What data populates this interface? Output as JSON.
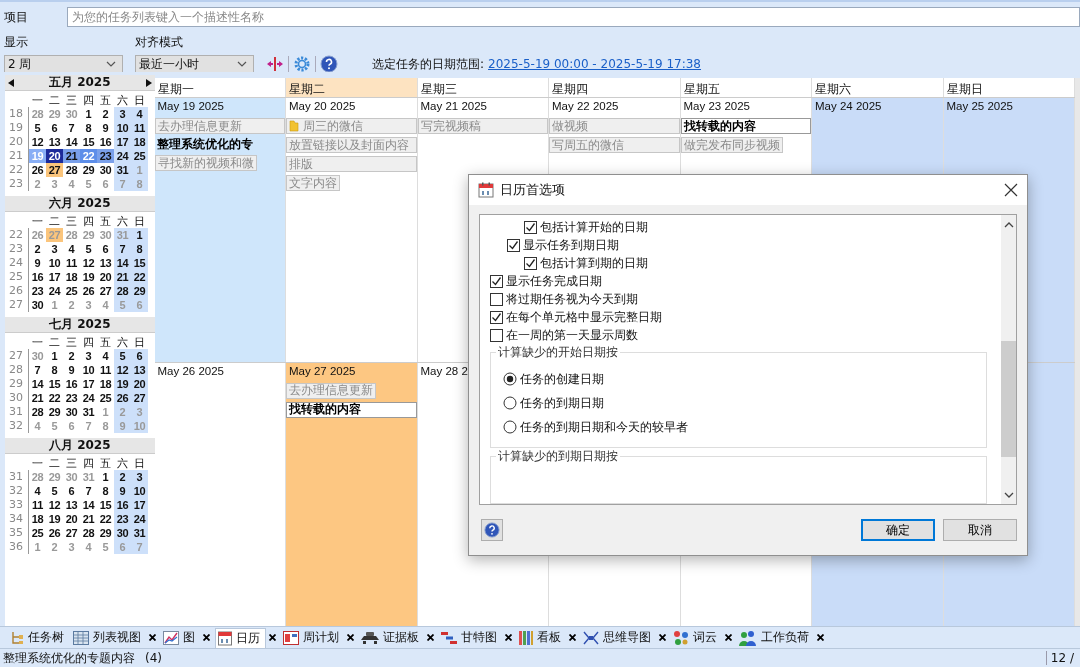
{
  "project": {
    "label": "项目",
    "placeholder": "为您的任务列表键入一个描述性名称"
  },
  "display": {
    "label": "显示",
    "value": "2 周"
  },
  "snap": {
    "label": "对齐模式",
    "value": "最近一小时"
  },
  "range": {
    "label": "选定任务的日期范围:",
    "link": "2025-5-19 00:00 - 2025-5-19 17:38"
  },
  "mini_calendars": [
    {
      "title": "五月 2025",
      "arrows": true,
      "weekdays": [
        "一",
        "二",
        "三",
        "四",
        "五",
        "六",
        "日"
      ],
      "weeks": [
        {
          "number": "18",
          "days": [
            {
              "n": "28",
              "kind": "muted"
            },
            {
              "n": "29",
              "kind": "muted"
            },
            {
              "n": "30",
              "kind": "muted"
            },
            {
              "n": "1",
              "kind": "normal"
            },
            {
              "n": "2",
              "kind": "normal"
            },
            {
              "n": "3",
              "kind": "normal"
            },
            {
              "n": "4",
              "kind": "normal"
            }
          ]
        },
        {
          "number": "19",
          "days": [
            {
              "n": "5",
              "kind": "normal"
            },
            {
              "n": "6",
              "kind": "normal"
            },
            {
              "n": "7",
              "kind": "normal"
            },
            {
              "n": "8",
              "kind": "normal"
            },
            {
              "n": "9",
              "kind": "normal"
            },
            {
              "n": "10",
              "kind": "normal"
            },
            {
              "n": "11",
              "kind": "normal"
            }
          ]
        },
        {
          "number": "20",
          "days": [
            {
              "n": "12",
              "kind": "normal"
            },
            {
              "n": "13",
              "kind": "normal"
            },
            {
              "n": "14",
              "kind": "normal"
            },
            {
              "n": "15",
              "kind": "normal"
            },
            {
              "n": "16",
              "kind": "normal"
            },
            {
              "n": "17",
              "kind": "normal"
            },
            {
              "n": "18",
              "kind": "normal"
            }
          ]
        },
        {
          "number": "21",
          "days": [
            {
              "n": "19",
              "kind": "pale"
            },
            {
              "n": "20",
              "kind": "focused"
            },
            {
              "n": "21",
              "kind": "selected"
            },
            {
              "n": "22",
              "kind": "mid"
            },
            {
              "n": "23",
              "kind": "selected"
            },
            {
              "n": "24",
              "kind": "normal"
            },
            {
              "n": "25",
              "kind": "normal"
            }
          ]
        },
        {
          "number": "22",
          "days": [
            {
              "n": "26",
              "kind": "normal"
            },
            {
              "n": "27",
              "kind": "today"
            },
            {
              "n": "28",
              "kind": "normal"
            },
            {
              "n": "29",
              "kind": "normal"
            },
            {
              "n": "30",
              "kind": "normal"
            },
            {
              "n": "31",
              "kind": "normal"
            },
            {
              "n": "1",
              "kind": "muted"
            }
          ]
        },
        {
          "number": "23",
          "days": [
            {
              "n": "2",
              "kind": "muted"
            },
            {
              "n": "3",
              "kind": "muted"
            },
            {
              "n": "4",
              "kind": "muted"
            },
            {
              "n": "5",
              "kind": "muted"
            },
            {
              "n": "6",
              "kind": "muted"
            },
            {
              "n": "7",
              "kind": "muted"
            },
            {
              "n": "8",
              "kind": "muted"
            }
          ]
        }
      ]
    },
    {
      "title": "六月 2025",
      "arrows": false,
      "weekdays": [
        "一",
        "二",
        "三",
        "四",
        "五",
        "六",
        "日"
      ],
      "weeks": [
        {
          "number": "22",
          "days": [
            {
              "n": "26",
              "kind": "muted"
            },
            {
              "n": "27",
              "kind": "faded"
            },
            {
              "n": "28",
              "kind": "muted"
            },
            {
              "n": "29",
              "kind": "muted"
            },
            {
              "n": "30",
              "kind": "muted"
            },
            {
              "n": "31",
              "kind": "muted"
            },
            {
              "n": "1",
              "kind": "normal"
            }
          ]
        },
        {
          "number": "23",
          "days": [
            {
              "n": "2",
              "kind": "normal"
            },
            {
              "n": "3",
              "kind": "normal"
            },
            {
              "n": "4",
              "kind": "normal"
            },
            {
              "n": "5",
              "kind": "normal"
            },
            {
              "n": "6",
              "kind": "normal"
            },
            {
              "n": "7",
              "kind": "normal"
            },
            {
              "n": "8",
              "kind": "normal"
            }
          ]
        },
        {
          "number": "24",
          "days": [
            {
              "n": "9",
              "kind": "normal"
            },
            {
              "n": "10",
              "kind": "normal"
            },
            {
              "n": "11",
              "kind": "normal"
            },
            {
              "n": "12",
              "kind": "normal"
            },
            {
              "n": "13",
              "kind": "normal"
            },
            {
              "n": "14",
              "kind": "normal"
            },
            {
              "n": "15",
              "kind": "normal"
            }
          ]
        },
        {
          "number": "25",
          "days": [
            {
              "n": "16",
              "kind": "normal"
            },
            {
              "n": "17",
              "kind": "normal"
            },
            {
              "n": "18",
              "kind": "normal"
            },
            {
              "n": "19",
              "kind": "normal"
            },
            {
              "n": "20",
              "kind": "normal"
            },
            {
              "n": "21",
              "kind": "normal"
            },
            {
              "n": "22",
              "kind": "normal"
            }
          ]
        },
        {
          "number": "26",
          "days": [
            {
              "n": "23",
              "kind": "normal"
            },
            {
              "n": "24",
              "kind": "normal"
            },
            {
              "n": "25",
              "kind": "normal"
            },
            {
              "n": "26",
              "kind": "normal"
            },
            {
              "n": "27",
              "kind": "normal"
            },
            {
              "n": "28",
              "kind": "normal"
            },
            {
              "n": "29",
              "kind": "normal"
            }
          ]
        },
        {
          "number": "27",
          "days": [
            {
              "n": "30",
              "kind": "normal"
            },
            {
              "n": "1",
              "kind": "muted"
            },
            {
              "n": "2",
              "kind": "muted"
            },
            {
              "n": "3",
              "kind": "muted"
            },
            {
              "n": "4",
              "kind": "muted"
            },
            {
              "n": "5",
              "kind": "muted"
            },
            {
              "n": "6",
              "kind": "muted"
            }
          ]
        }
      ]
    },
    {
      "title": "七月 2025",
      "arrows": false,
      "weekdays": [
        "一",
        "二",
        "三",
        "四",
        "五",
        "六",
        "日"
      ],
      "weeks": [
        {
          "number": "27",
          "days": [
            {
              "n": "30",
              "kind": "muted"
            },
            {
              "n": "1",
              "kind": "normal"
            },
            {
              "n": "2",
              "kind": "normal"
            },
            {
              "n": "3",
              "kind": "normal"
            },
            {
              "n": "4",
              "kind": "normal"
            },
            {
              "n": "5",
              "kind": "normal"
            },
            {
              "n": "6",
              "kind": "normal"
            }
          ]
        },
        {
          "number": "28",
          "days": [
            {
              "n": "7",
              "kind": "normal"
            },
            {
              "n": "8",
              "kind": "normal"
            },
            {
              "n": "9",
              "kind": "normal"
            },
            {
              "n": "10",
              "kind": "normal"
            },
            {
              "n": "11",
              "kind": "normal"
            },
            {
              "n": "12",
              "kind": "normal"
            },
            {
              "n": "13",
              "kind": "normal"
            }
          ]
        },
        {
          "number": "29",
          "days": [
            {
              "n": "14",
              "kind": "normal"
            },
            {
              "n": "15",
              "kind": "normal"
            },
            {
              "n": "16",
              "kind": "normal"
            },
            {
              "n": "17",
              "kind": "normal"
            },
            {
              "n": "18",
              "kind": "normal"
            },
            {
              "n": "19",
              "kind": "normal"
            },
            {
              "n": "20",
              "kind": "normal"
            }
          ]
        },
        {
          "number": "30",
          "days": [
            {
              "n": "21",
              "kind": "normal"
            },
            {
              "n": "22",
              "kind": "normal"
            },
            {
              "n": "23",
              "kind": "normal"
            },
            {
              "n": "24",
              "kind": "normal"
            },
            {
              "n": "25",
              "kind": "normal"
            },
            {
              "n": "26",
              "kind": "normal"
            },
            {
              "n": "27",
              "kind": "normal"
            }
          ]
        },
        {
          "number": "31",
          "days": [
            {
              "n": "28",
              "kind": "normal"
            },
            {
              "n": "29",
              "kind": "normal"
            },
            {
              "n": "30",
              "kind": "normal"
            },
            {
              "n": "31",
              "kind": "normal"
            },
            {
              "n": "1",
              "kind": "muted"
            },
            {
              "n": "2",
              "kind": "muted"
            },
            {
              "n": "3",
              "kind": "muted"
            }
          ]
        },
        {
          "number": "32",
          "days": [
            {
              "n": "4",
              "kind": "muted"
            },
            {
              "n": "5",
              "kind": "muted"
            },
            {
              "n": "6",
              "kind": "muted"
            },
            {
              "n": "7",
              "kind": "muted"
            },
            {
              "n": "8",
              "kind": "muted"
            },
            {
              "n": "9",
              "kind": "muted"
            },
            {
              "n": "10",
              "kind": "muted"
            }
          ]
        }
      ]
    },
    {
      "title": "八月 2025",
      "arrows": false,
      "weekdays": [
        "一",
        "二",
        "三",
        "四",
        "五",
        "六",
        "日"
      ],
      "weeks": [
        {
          "number": "31",
          "days": [
            {
              "n": "28",
              "kind": "muted"
            },
            {
              "n": "29",
              "kind": "muted"
            },
            {
              "n": "30",
              "kind": "muted"
            },
            {
              "n": "31",
              "kind": "muted"
            },
            {
              "n": "1",
              "kind": "normal"
            },
            {
              "n": "2",
              "kind": "normal"
            },
            {
              "n": "3",
              "kind": "normal"
            }
          ]
        },
        {
          "number": "32",
          "days": [
            {
              "n": "4",
              "kind": "normal"
            },
            {
              "n": "5",
              "kind": "normal"
            },
            {
              "n": "6",
              "kind": "normal"
            },
            {
              "n": "7",
              "kind": "normal"
            },
            {
              "n": "8",
              "kind": "normal"
            },
            {
              "n": "9",
              "kind": "normal"
            },
            {
              "n": "10",
              "kind": "normal"
            }
          ]
        },
        {
          "number": "33",
          "days": [
            {
              "n": "11",
              "kind": "normal"
            },
            {
              "n": "12",
              "kind": "normal"
            },
            {
              "n": "13",
              "kind": "normal"
            },
            {
              "n": "14",
              "kind": "normal"
            },
            {
              "n": "15",
              "kind": "normal"
            },
            {
              "n": "16",
              "kind": "normal"
            },
            {
              "n": "17",
              "kind": "normal"
            }
          ]
        },
        {
          "number": "34",
          "days": [
            {
              "n": "18",
              "kind": "normal"
            },
            {
              "n": "19",
              "kind": "normal"
            },
            {
              "n": "20",
              "kind": "normal"
            },
            {
              "n": "21",
              "kind": "normal"
            },
            {
              "n": "22",
              "kind": "normal"
            },
            {
              "n": "23",
              "kind": "normal"
            },
            {
              "n": "24",
              "kind": "normal"
            }
          ]
        },
        {
          "number": "35",
          "days": [
            {
              "n": "25",
              "kind": "normal"
            },
            {
              "n": "26",
              "kind": "normal"
            },
            {
              "n": "27",
              "kind": "normal"
            },
            {
              "n": "28",
              "kind": "normal"
            },
            {
              "n": "29",
              "kind": "normal"
            },
            {
              "n": "30",
              "kind": "normal"
            },
            {
              "n": "31",
              "kind": "normal"
            }
          ]
        },
        {
          "number": "36",
          "days": [
            {
              "n": "1",
              "kind": "muted"
            },
            {
              "n": "2",
              "kind": "muted"
            },
            {
              "n": "3",
              "kind": "muted"
            },
            {
              "n": "4",
              "kind": "muted"
            },
            {
              "n": "5",
              "kind": "muted"
            },
            {
              "n": "6",
              "kind": "muted"
            },
            {
              "n": "7",
              "kind": "muted"
            }
          ]
        }
      ]
    }
  ],
  "calendar": {
    "day_names": [
      {
        "label": "星期一",
        "today": false
      },
      {
        "label": "星期二",
        "today": true
      },
      {
        "label": "星期三",
        "today": false
      },
      {
        "label": "星期四",
        "today": false
      },
      {
        "label": "星期五",
        "today": false
      },
      {
        "label": "星期六",
        "today": false
      },
      {
        "label": "星期日",
        "today": false
      }
    ],
    "weeks": [
      {
        "days": [
          {
            "date": "May 19 2025",
            "kind": "selected",
            "tasks": [
              {
                "title": "去办理信息更新",
                "kind": "done",
                "full": true,
                "folder": false
              },
              {
                "title": "整理系统优化的专",
                "kind": "current",
                "full": true,
                "folder": false
              },
              {
                "title": "寻找新的视频和微",
                "kind": "done",
                "full": false,
                "folder": false
              }
            ]
          },
          {
            "date": "May 20 2025",
            "kind": "plain",
            "tasks": [
              {
                "title": "周三的微信",
                "kind": "done",
                "full": true,
                "folder": true
              },
              {
                "title": "放置链接以及封面内容",
                "kind": "done",
                "full": true,
                "folder": false
              },
              {
                "title": "排版",
                "kind": "done",
                "full": true,
                "folder": false
              },
              {
                "title": "文字内容",
                "kind": "done",
                "full": false,
                "folder": false
              }
            ]
          },
          {
            "date": "May 21 2025",
            "kind": "plain",
            "tasks": [
              {
                "title": "写完视频稿",
                "kind": "done",
                "full": true,
                "folder": false
              }
            ]
          },
          {
            "date": "May 22 2025",
            "kind": "plain",
            "tasks": [
              {
                "title": "做视频",
                "kind": "done",
                "full": true,
                "folder": false
              },
              {
                "title": "写周五的微信",
                "kind": "done",
                "full": true,
                "folder": false
              }
            ]
          },
          {
            "date": "May 23 2025",
            "kind": "plain",
            "tasks": [
              {
                "title": "找转载的内容",
                "kind": "open",
                "full": true,
                "folder": false
              },
              {
                "title": "做完发布同步视频",
                "kind": "done",
                "full": false,
                "folder": false
              }
            ]
          },
          {
            "date": "May 24 2025",
            "kind": "weekend"
          },
          {
            "date": "May 25 2025",
            "kind": "weekend"
          }
        ]
      },
      {
        "days": [
          {
            "date": "May 26 2025",
            "kind": "plain"
          },
          {
            "date": "May 27 2025",
            "kind": "today",
            "tasks": [
              {
                "title": "去办理信息更新",
                "kind": "done",
                "full": false,
                "folder": false
              },
              {
                "title": "找转载的内容",
                "kind": "open",
                "full": true,
                "folder": false
              }
            ]
          },
          {
            "date": "May 28 2",
            "kind": "plain"
          },
          {
            "kind": "plain"
          },
          {
            "kind": "plain"
          },
          {
            "kind": "weekend"
          },
          {
            "kind": "weekend"
          }
        ]
      }
    ]
  },
  "dialog": {
    "title": "日历首选项",
    "options": [
      {
        "children": [
          {
            "children": [
              {
                "label": "包括计算开始的日期",
                "checked": true
              }
            ]
          },
          {
            "label": "显示任务到期日期",
            "checked": true,
            "children": [
              {
                "label": "包括计算到期的日期",
                "checked": true
              }
            ]
          }
        ]
      },
      {
        "label": "显示任务完成日期",
        "checked": true
      },
      {
        "label": "将过期任务视为今天到期",
        "checked": false
      },
      {
        "label": "在每个单元格中显示完整日期",
        "checked": true
      },
      {
        "label": "在一周的第一天显示周数",
        "checked": false
      }
    ],
    "groups": [
      {
        "title": "计算缺少的开始日期按",
        "choices": [
          {
            "label": "任务的创建日期",
            "selected": true
          },
          {
            "label": "任务的到期日期",
            "selected": false
          },
          {
            "label": "任务的到期日期和今天的较早者",
            "selected": false
          }
        ]
      },
      {
        "title": "计算缺少的到期日期按"
      }
    ],
    "buttons": [
      {
        "label": "确定",
        "default": true
      },
      {
        "label": "取消",
        "default": false
      }
    ]
  },
  "tabs": [
    {
      "label": "任务树",
      "selected": false,
      "closable": false
    },
    {
      "label": "列表视图",
      "selected": false,
      "closable": true
    },
    {
      "label": "图",
      "selected": false,
      "closable": true
    },
    {
      "label": "日历",
      "selected": true,
      "closable": true
    },
    {
      "label": "周计划",
      "selected": false,
      "closable": true
    },
    {
      "label": "证据板",
      "selected": false,
      "closable": true
    },
    {
      "label": "甘特图",
      "selected": false,
      "closable": true
    },
    {
      "label": "看板",
      "selected": false,
      "closable": true
    },
    {
      "label": "思维导图",
      "selected": false,
      "closable": true
    },
    {
      "label": "词云",
      "selected": false,
      "closable": true
    },
    {
      "label": "工作负荷",
      "selected": false,
      "closable": true
    }
  ],
  "status_bar": {
    "text": "整理系统优化的专题内容",
    "count": "(4)",
    "page": "12 /"
  }
}
